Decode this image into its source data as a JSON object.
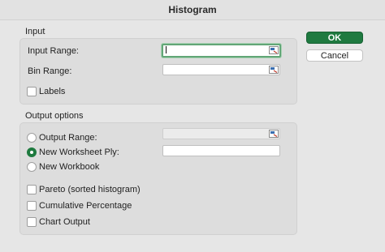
{
  "dialog": {
    "title": "Histogram"
  },
  "input_group": {
    "label": "Input",
    "input_range_label": "Input Range:",
    "input_range_value": "",
    "bin_range_label": "Bin Range:",
    "bin_range_value": "",
    "labels_checkbox": "Labels",
    "labels_checked": false
  },
  "output_group": {
    "label": "Output options",
    "output_range_label": "Output Range:",
    "output_range_value": "",
    "new_worksheet_label": "New Worksheet Ply:",
    "new_worksheet_value": "",
    "new_workbook_label": "New Workbook",
    "selected_option": "New Worksheet Ply:",
    "pareto_label": "Pareto (sorted histogram)",
    "cumulative_label": "Cumulative Percentage",
    "chart_output_label": "Chart Output"
  },
  "buttons": {
    "ok": "OK",
    "cancel": "Cancel"
  },
  "colors": {
    "accent": "#1f7a40",
    "focus_ring": "#62a677"
  },
  "icons": {
    "range_picker": "collapse-dialog-icon"
  }
}
